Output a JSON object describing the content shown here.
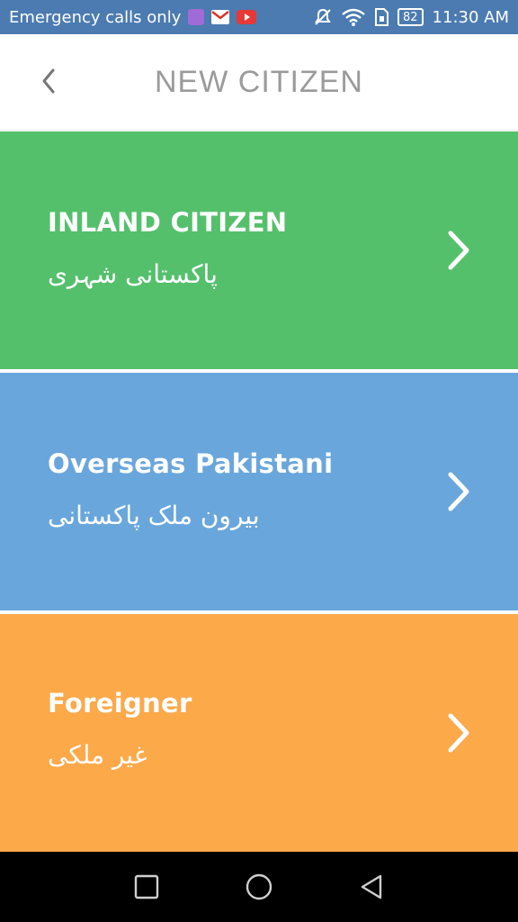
{
  "status_bar": {
    "carrier_text": "Emergency calls only",
    "battery_level": "82",
    "time": "11:30 AM",
    "icons": [
      "gallery-icon",
      "gmail-icon",
      "youtube-icon",
      "mute-icon",
      "wifi-icon",
      "sim-icon",
      "battery-icon"
    ]
  },
  "app_bar": {
    "title": "NEW CITIZEN",
    "back_icon": "chevron-left-icon"
  },
  "options": [
    {
      "title": "INLAND CITIZEN",
      "subtitle_urdu": "پاکستانی شہری",
      "color": "#55c06c"
    },
    {
      "title": "Overseas Pakistani",
      "subtitle_urdu": "بیرون ملک پاکستانی",
      "color": "#69a6dc"
    },
    {
      "title": "Foreigner",
      "subtitle_urdu": "غیر ملکی",
      "color": "#fca94a"
    }
  ],
  "nav_bar": {
    "buttons": [
      "recents-square-icon",
      "home-circle-icon",
      "back-triangle-icon"
    ]
  }
}
